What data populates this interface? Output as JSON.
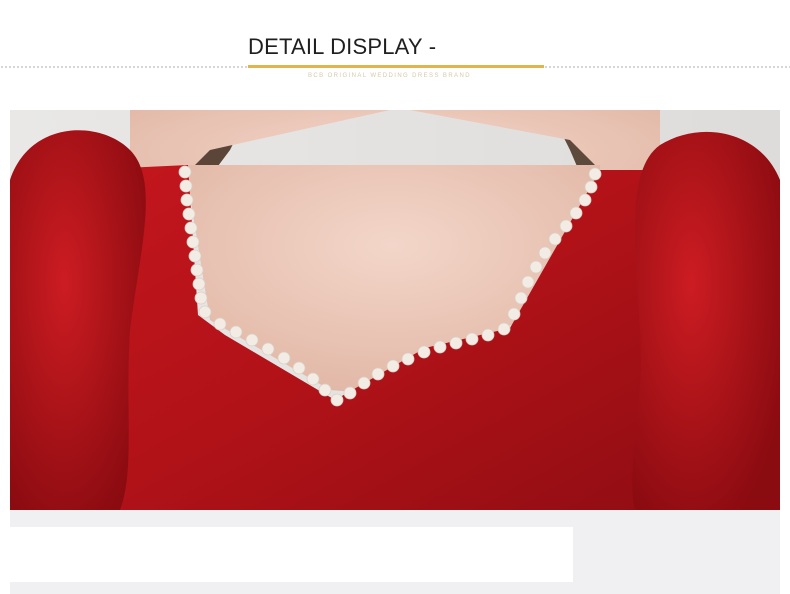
{
  "header": {
    "title": "DETAIL DISPLAY -",
    "subtitle": "BCB ORIGINAL WEDDING DRESS BRAND",
    "accent_color": "#e2b44d"
  },
  "photo": {
    "subject": "red-velvet-dress-neckline",
    "dress_color": "#b01218",
    "trim_color": "#f3ece4"
  }
}
